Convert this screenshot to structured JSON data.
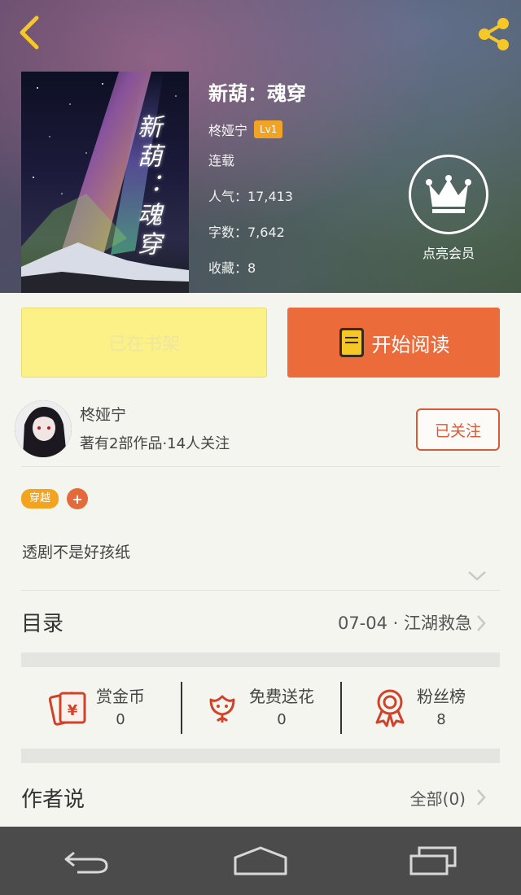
{
  "book": {
    "title": "新葫：魂穿",
    "cover_title": "新葫：魂穿",
    "author": "柊娅宁",
    "author_level": "Lv1",
    "status": "连载",
    "popularity": "人气：17,413",
    "word_count": "字数：7,642",
    "favorites": "收藏：8"
  },
  "vip": {
    "label": "点亮会员"
  },
  "actions": {
    "shelf_label": "已在书架",
    "read_label": "开始阅读"
  },
  "author_card": {
    "name": "柊娅宁",
    "stats": "著有2部作品·14人关注",
    "follow_label": "已关注"
  },
  "tags": {
    "items": [
      "穿越"
    ],
    "add_label": "+"
  },
  "description": "透剧不是好孩纸",
  "catalog": {
    "title": "目录",
    "latest": "07-04 · 江湖救急"
  },
  "stats": {
    "reward": {
      "label": "赏金币",
      "count": "0"
    },
    "flowers": {
      "label": "免费送花",
      "count": "0"
    },
    "fans": {
      "label": "粉丝榜",
      "count": "8"
    }
  },
  "author_says": {
    "title": "作者说",
    "all_label": "全部(0)"
  },
  "colors": {
    "accent_orange": "#ec6b3a",
    "shelf_yellow": "#fbf186",
    "tag_yellow": "#f2a41e",
    "follow_red": "#d85a3a",
    "icon_red": "#d0432b",
    "header_yellow": "#f5c826"
  },
  "icons": {
    "back": "chevron-left-icon",
    "share": "share-icon",
    "vip": "crown-icon",
    "read": "book-icon",
    "reward": "red-envelope-icon",
    "flowers": "flower-icon",
    "fans": "medal-icon"
  }
}
